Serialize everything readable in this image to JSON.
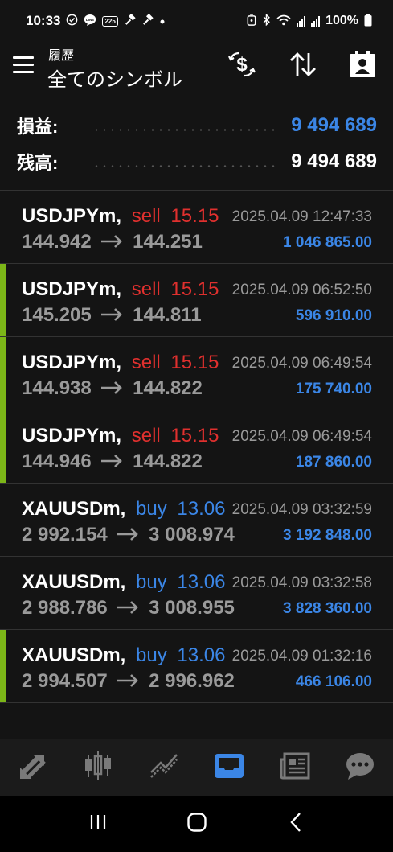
{
  "status_bar": {
    "time": "10:33",
    "battery": "100%",
    "notification_badge": "225"
  },
  "header": {
    "subtitle": "履歴",
    "title": "全てのシンボル"
  },
  "balance": {
    "profit_label": "損益:",
    "profit_value": "9 494 689",
    "balance_label": "残高:",
    "balance_value": "9 494 689"
  },
  "colors": {
    "accent_blue": "#3b86e6",
    "sell_red": "#e0302e",
    "accent_green": "#7cb618"
  },
  "trades": [
    {
      "symbol": "USDJPYm,",
      "side": "sell",
      "side_type": "sell",
      "volume": "15.15",
      "time": "2025.04.09 12:47:33",
      "open": "144.942",
      "close": "144.251",
      "profit": "1 046 865.00",
      "marked": false
    },
    {
      "symbol": "USDJPYm,",
      "side": "sell",
      "side_type": "sell",
      "volume": "15.15",
      "time": "2025.04.09 06:52:50",
      "open": "145.205",
      "close": "144.811",
      "profit": "596 910.00",
      "marked": true
    },
    {
      "symbol": "USDJPYm,",
      "side": "sell",
      "side_type": "sell",
      "volume": "15.15",
      "time": "2025.04.09 06:49:54",
      "open": "144.938",
      "close": "144.822",
      "profit": "175 740.00",
      "marked": true
    },
    {
      "symbol": "USDJPYm,",
      "side": "sell",
      "side_type": "sell",
      "volume": "15.15",
      "time": "2025.04.09 06:49:54",
      "open": "144.946",
      "close": "144.822",
      "profit": "187 860.00",
      "marked": true
    },
    {
      "symbol": "XAUUSDm,",
      "side": "buy",
      "side_type": "buy",
      "volume": "13.06",
      "time": "2025.04.09 03:32:59",
      "open": "2 992.154",
      "close": "3 008.974",
      "profit": "3 192 848.00",
      "marked": false
    },
    {
      "symbol": "XAUUSDm,",
      "side": "buy",
      "side_type": "buy",
      "volume": "13.06",
      "time": "2025.04.09 03:32:58",
      "open": "2 988.786",
      "close": "3 008.955",
      "profit": "3 828 360.00",
      "marked": false
    },
    {
      "symbol": "XAUUSDm,",
      "side": "buy",
      "side_type": "buy",
      "volume": "13.06",
      "time": "2025.04.09 01:32:16",
      "open": "2 994.507",
      "close": "2 996.962",
      "profit": "466 106.00",
      "marked": true
    }
  ],
  "bottom_nav": [
    {
      "name": "quotes",
      "icon": "quotes-arrows-icon",
      "active": false
    },
    {
      "name": "chart",
      "icon": "candlestick-chart-icon",
      "active": false
    },
    {
      "name": "trade",
      "icon": "trade-line-icon",
      "active": false
    },
    {
      "name": "history",
      "icon": "inbox-tray-icon",
      "active": true
    },
    {
      "name": "news",
      "icon": "newspaper-icon",
      "active": false
    },
    {
      "name": "messages",
      "icon": "chat-bubble-icon",
      "active": false
    }
  ]
}
